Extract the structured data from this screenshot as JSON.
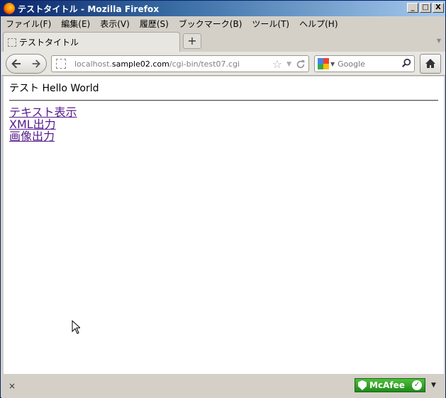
{
  "window": {
    "title": "テストタイトル - Mozilla Firefox",
    "controls": {
      "minimize": "_",
      "maximize": "□",
      "close": "X"
    }
  },
  "menubar": {
    "items": [
      {
        "label": "ファイル(F)"
      },
      {
        "label": "編集(E)"
      },
      {
        "label": "表示(V)"
      },
      {
        "label": "履歴(S)"
      },
      {
        "label": "ブックマーク(B)"
      },
      {
        "label": "ツール(T)"
      },
      {
        "label": "ヘルプ(H)"
      }
    ]
  },
  "tabs": {
    "active_label": "テストタイトル",
    "new_tab_label": "+",
    "list_arrow": "▼"
  },
  "nav": {
    "back_glyph": "🡐",
    "forward_glyph": "🡒",
    "url_prefix": "localhost.",
    "url_host": "sample02.com",
    "url_path": "/cgi-bin/test07.cgi",
    "bookmark_star": "☆",
    "dropdown": "▼",
    "reload": "C",
    "search_placeholder": "Google",
    "search_dd": "▼",
    "search_glass": "⌕",
    "home_glyph": "⌂"
  },
  "content": {
    "heading": "テスト Hello World",
    "links": [
      {
        "label": "テキスト表示"
      },
      {
        "label": "XML出力"
      },
      {
        "label": "画像出力"
      }
    ]
  },
  "statusbar": {
    "close_label": "×",
    "addon_label": "McAfee",
    "addon_check": "✓",
    "addon_dd": "▼"
  },
  "colors": {
    "link_visited": "#551a8b",
    "mcafee_green": "#1f8a1a",
    "titlebar_dark": "#0a246a"
  }
}
